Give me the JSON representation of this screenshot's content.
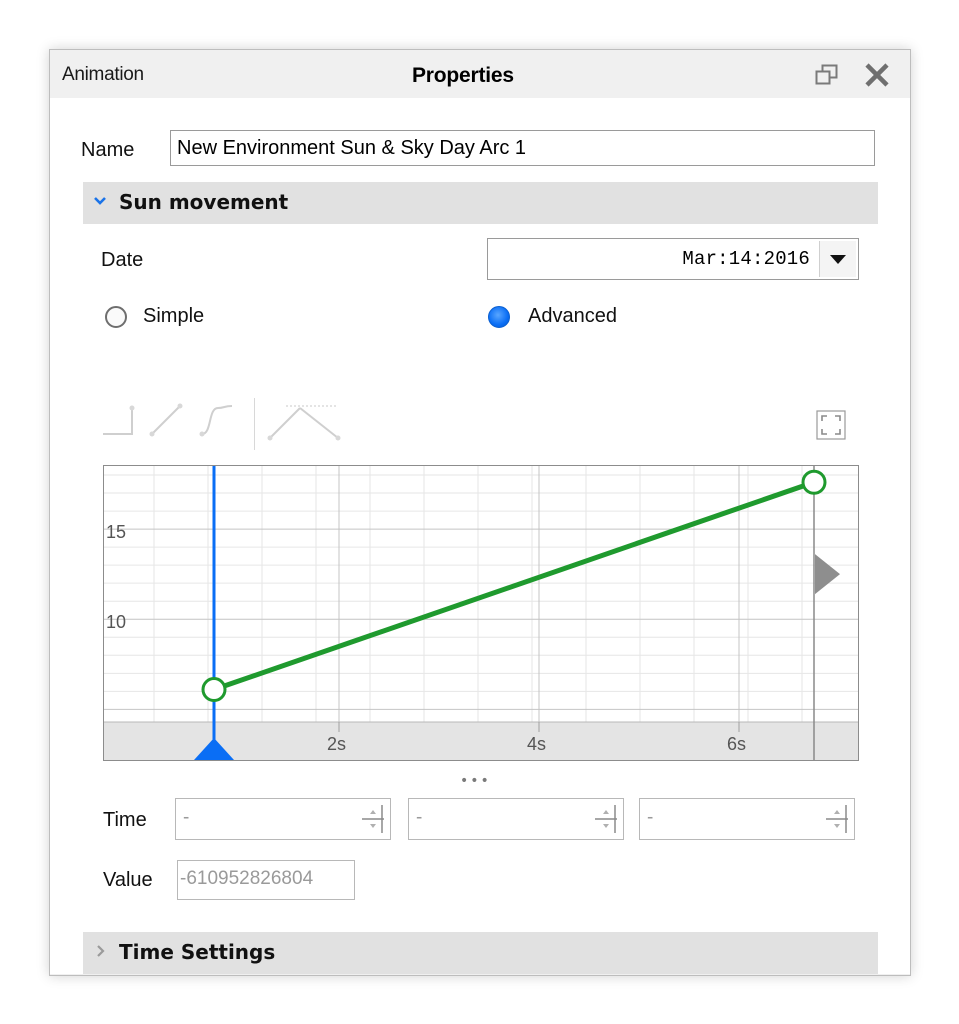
{
  "titlebar": {
    "tab_animation": "Animation",
    "tab_properties": "Properties",
    "icons": [
      "restore-icon",
      "close-icon"
    ]
  },
  "name": {
    "label": "Name",
    "value": "New Environment Sun & Sky Day Arc 1"
  },
  "sun_movement": {
    "title": "Sun movement",
    "expanded": true,
    "date_label": "Date",
    "date_value": "Mar:14:2016",
    "mode_options": [
      {
        "label": "Simple",
        "selected": false
      },
      {
        "label": "Advanced",
        "selected": true
      }
    ],
    "toolbar_icons": [
      "constant-interpolation-icon",
      "linear-interpolation-icon",
      "bezier-interpolation-icon",
      "peak-curve-icon",
      "fit-view-icon"
    ]
  },
  "chart_data": {
    "type": "line",
    "x_tick_labels": [
      "2s",
      "4s",
      "6s"
    ],
    "y_tick_labels": [
      "15",
      "10"
    ],
    "x_ticks": [
      2,
      4,
      6
    ],
    "y_ticks": [
      15,
      10
    ],
    "xlim": [
      0,
      7
    ],
    "ylim": [
      4.3,
      18.5
    ],
    "series": [
      {
        "color": "#1f9a2e",
        "points": [
          [
            0.75,
            6.1
          ],
          [
            6.75,
            17.6
          ]
        ]
      }
    ],
    "playhead_time": 0.75,
    "end_marker_time": 6.75
  },
  "more_label": "•••",
  "keyframe": {
    "time_label": "Time",
    "time_fields": [
      "-",
      "-",
      "-"
    ],
    "value_label": "Value",
    "value": "-610952826804"
  },
  "time_settings": {
    "title": "Time Settings",
    "expanded": false
  },
  "colors": {
    "accent": "#0a6ef5",
    "curve": "#1f9a2e",
    "header_bg": "#e1e1e1"
  }
}
